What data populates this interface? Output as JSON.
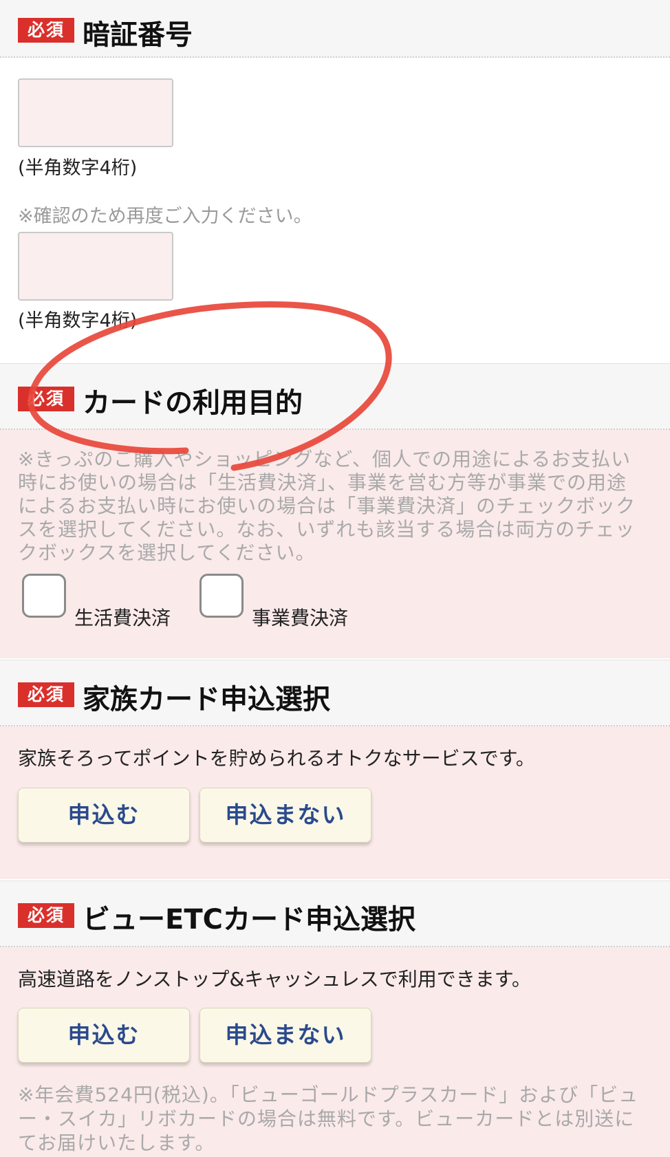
{
  "pin_section": {
    "badge": "必須",
    "title": "暗証番号",
    "hint1": "(半角数字4桁)",
    "confirm_note": "※確認のため再度ご入力ください。",
    "hint2": "(半角数字4桁)"
  },
  "purpose_section": {
    "badge": "必須",
    "title": "カードの利用目的",
    "description": "※きっぷのご購入やショッピングなど、個人での用途によるお支払い時にお使いの場合は「生活費決済」、事業を営む方等が事業での用途によるお支払い時にお使いの場合は「事業費決済」のチェックボックスを選択してください。なお、いずれも該当する場合は両方のチェックボックスを選択してください。",
    "option1": "生活費決済",
    "option2": "事業費決済"
  },
  "family_section": {
    "badge": "必須",
    "title": "家族カード申込選択",
    "text": "家族そろってポイントを貯められるオトクなサービスです。",
    "apply_label": "申込む",
    "decline_label": "申込まない"
  },
  "etc_section": {
    "badge": "必須",
    "title": "ビューETCカード申込選択",
    "text": "高速道路をノンストップ&キャッシュレスで利用できます。",
    "apply_label": "申込む",
    "decline_label": "申込まない",
    "note": "※年会費524円(税込)。「ビューゴールドプラスカード」および「ビュー・スイカ」リボカードの場合は無料です。ビューカードとは別送にてお届けいたします。"
  },
  "colors": {
    "required_badge": "#d9302c",
    "pink_background": "#fbeaea",
    "button_text": "#2a4a8c",
    "annotation_circle": "#e8463a"
  }
}
